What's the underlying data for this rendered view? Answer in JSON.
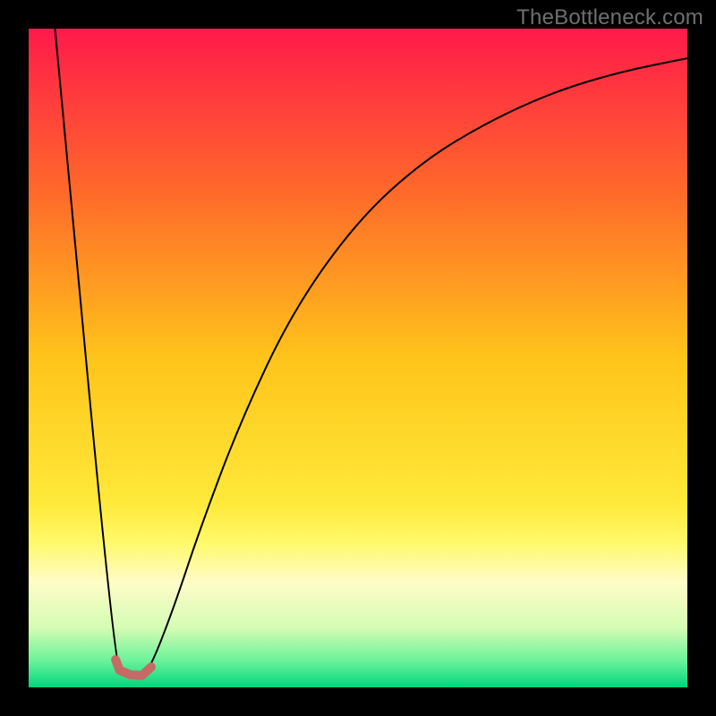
{
  "watermark": "TheBottleneck.com",
  "chart_data": {
    "type": "line",
    "title": "",
    "xlabel": "",
    "ylabel": "",
    "xlim": [
      0,
      100
    ],
    "ylim": [
      0,
      100
    ],
    "background_gradient": {
      "stops": [
        {
          "offset": 0.0,
          "color": "#ff1a4a"
        },
        {
          "offset": 0.25,
          "color": "#ff6a2a"
        },
        {
          "offset": 0.5,
          "color": "#ffc41a"
        },
        {
          "offset": 0.72,
          "color": "#ffe93a"
        },
        {
          "offset": 0.78,
          "color": "#fff96a"
        },
        {
          "offset": 0.84,
          "color": "#fffcc8"
        },
        {
          "offset": 0.91,
          "color": "#d4fcb4"
        },
        {
          "offset": 0.96,
          "color": "#6af29a"
        },
        {
          "offset": 1.0,
          "color": "#00d67d"
        }
      ]
    },
    "series": [
      {
        "name": "bottleneck-curve",
        "color": "#000000",
        "stroke_width": 2.0,
        "points": [
          {
            "x": 4.0,
            "y": 100.0
          },
          {
            "x": 13.0,
            "y": 4.0
          },
          {
            "x": 14.5,
            "y": 2.0
          },
          {
            "x": 17.0,
            "y": 1.7
          },
          {
            "x": 18.5,
            "y": 3.0
          },
          {
            "x": 22.0,
            "y": 12.0
          },
          {
            "x": 26.0,
            "y": 24.0
          },
          {
            "x": 32.0,
            "y": 40.0
          },
          {
            "x": 40.0,
            "y": 57.0
          },
          {
            "x": 50.0,
            "y": 71.0
          },
          {
            "x": 60.0,
            "y": 80.0
          },
          {
            "x": 70.0,
            "y": 86.0
          },
          {
            "x": 80.0,
            "y": 90.5
          },
          {
            "x": 90.0,
            "y": 93.5
          },
          {
            "x": 100.0,
            "y": 95.5
          }
        ]
      }
    ],
    "marker": {
      "name": "optimal-region",
      "color": "#c76964",
      "stroke_width": 10,
      "points": [
        {
          "x": 13.2,
          "y": 4.2
        },
        {
          "x": 13.8,
          "y": 2.6
        },
        {
          "x": 15.5,
          "y": 1.9
        },
        {
          "x": 17.2,
          "y": 1.8
        },
        {
          "x": 18.6,
          "y": 3.1
        }
      ]
    }
  }
}
